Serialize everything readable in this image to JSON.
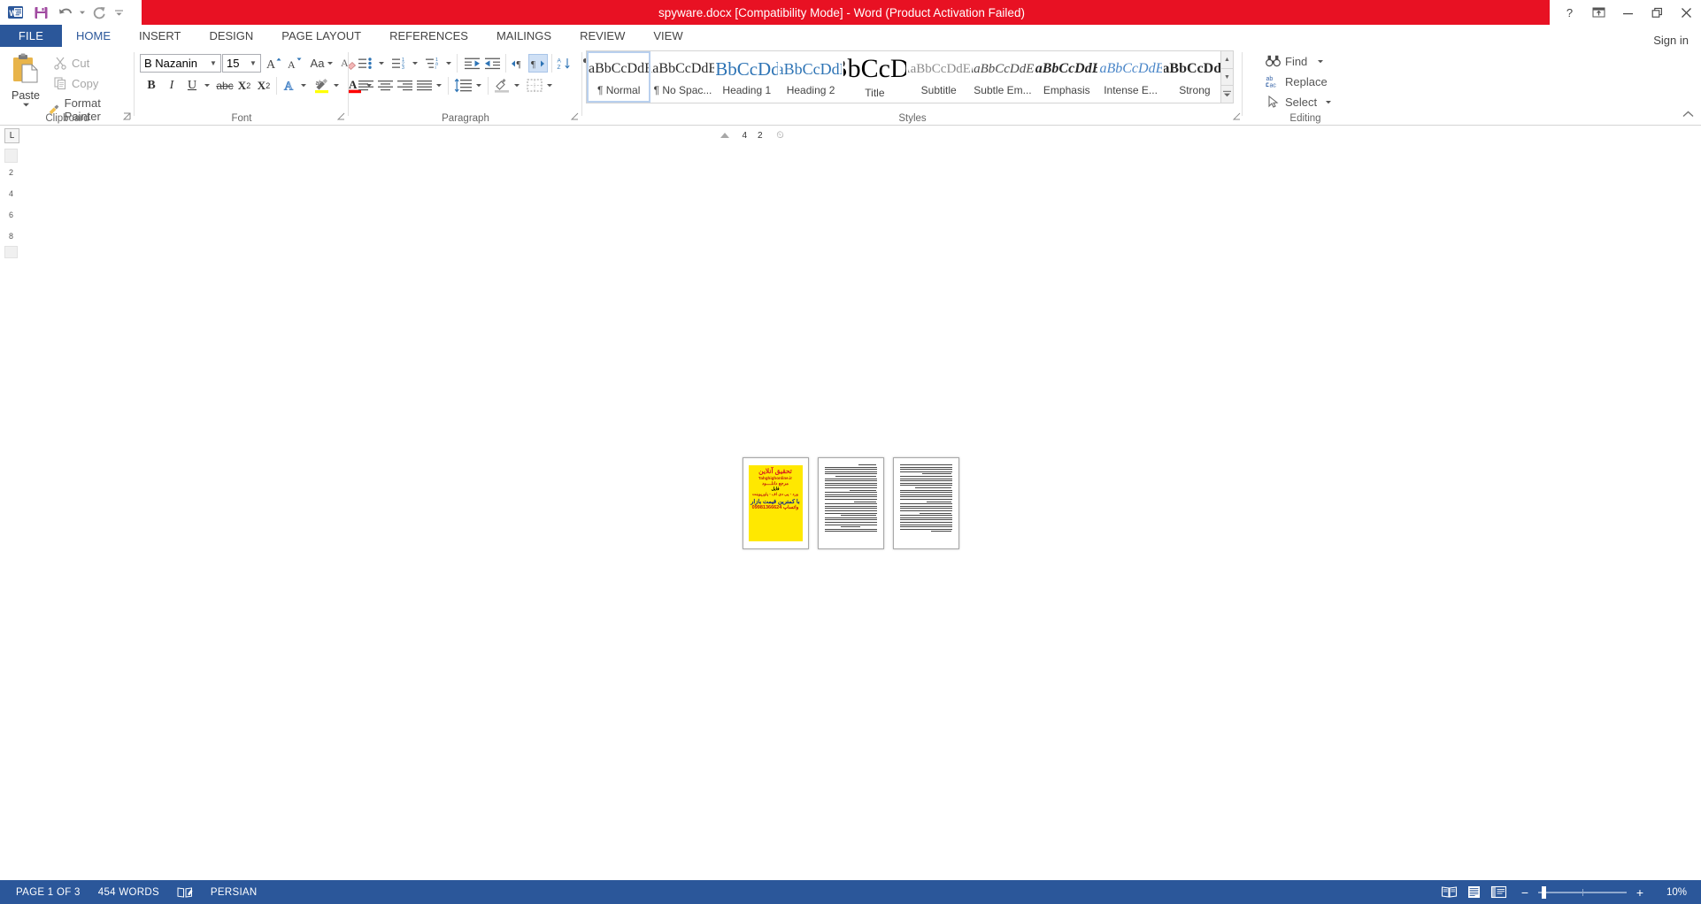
{
  "titlebar": {
    "title": "spyware.docx [Compatibility Mode]  -  Word (Product Activation Failed)",
    "quick_access": [
      {
        "name": "word-logo-icon",
        "label": "W"
      },
      {
        "name": "save-icon",
        "label": "Save"
      },
      {
        "name": "undo-icon",
        "label": "Undo"
      },
      {
        "name": "redo-icon",
        "label": "Redo"
      },
      {
        "name": "customize-qat-icon",
        "label": "Customize Quick Access Toolbar"
      }
    ],
    "help": "?",
    "ribbon_display": "Ribbon Display Options",
    "minimize": "—",
    "restore": "❐",
    "close": "✕",
    "accent_red": "#e81123",
    "accent_blue": "#2b579a"
  },
  "tabs": {
    "file": "FILE",
    "items": [
      {
        "label": "HOME",
        "active": true
      },
      {
        "label": "INSERT",
        "active": false
      },
      {
        "label": "DESIGN",
        "active": false
      },
      {
        "label": "PAGE LAYOUT",
        "active": false
      },
      {
        "label": "REFERENCES",
        "active": false
      },
      {
        "label": "MAILINGS",
        "active": false
      },
      {
        "label": "REVIEW",
        "active": false
      },
      {
        "label": "VIEW",
        "active": false
      }
    ],
    "signin": "Sign in"
  },
  "ribbon": {
    "clipboard": {
      "group_label": "Clipboard",
      "paste": "Paste",
      "cut": "Cut",
      "copy": "Copy",
      "format_painter": "Format Painter"
    },
    "font": {
      "group_label": "Font",
      "font_name": "B Nazanin",
      "font_size": "15",
      "grow_font": "A",
      "shrink_font": "A",
      "change_case": "Aa",
      "clear_formatting": "Clear All Formatting",
      "bold": "B",
      "italic": "I",
      "underline": "U",
      "strikethrough": "abc",
      "subscript": "X",
      "subscript_sub": "2",
      "superscript": "X",
      "superscript_sup": "2",
      "text_effects": "A",
      "highlight": "ab",
      "font_color": "A",
      "highlight_color": "#ffff00",
      "font_color_value": "#ff0000"
    },
    "paragraph": {
      "group_label": "Paragraph",
      "bullets": "Bullets",
      "numbering": "Numbering",
      "multilevel": "Multilevel List",
      "decrease_indent": "Decrease Indent",
      "increase_indent": "Increase Indent",
      "ltr": "Left-to-Right Text Direction",
      "rtl": "Right-to-Left Text Direction",
      "rtl_active": true,
      "sort": "Sort",
      "show_marks": "Show/Hide ¶",
      "align_left": "Align Left",
      "align_center": "Center",
      "align_right": "Align Right",
      "justify": "Justify",
      "line_spacing": "Line and Paragraph Spacing",
      "shading": "Shading",
      "borders": "Borders"
    },
    "styles": {
      "group_label": "Styles",
      "items": [
        {
          "preview": "AaBbCcDdEe",
          "name": "¶ Normal",
          "selected": true,
          "color": "#2a2a2a",
          "size": 16,
          "style": "normal",
          "weight": "normal"
        },
        {
          "preview": "AaBbCcDdEe",
          "name": "¶ No Spac...",
          "selected": false,
          "color": "#2a2a2a",
          "size": 16,
          "style": "normal",
          "weight": "normal"
        },
        {
          "preview": "AaBbCcDdEe",
          "name": "Heading 1",
          "selected": false,
          "color": "#2e74b5",
          "size": 21,
          "style": "normal",
          "weight": "normal"
        },
        {
          "preview": "AaBbCcDdEe",
          "name": "Heading 2",
          "selected": false,
          "color": "#2e74b5",
          "size": 18,
          "style": "normal",
          "weight": "normal"
        },
        {
          "preview": "AaBbCcDdEe",
          "name": "Title",
          "selected": false,
          "color": "#000000",
          "size": 30,
          "style": "normal",
          "weight": "normal"
        },
        {
          "preview": "AaBbCcDdEe",
          "name": "Subtitle",
          "selected": false,
          "color": "#8c8c8c",
          "size": 15,
          "style": "normal",
          "weight": "normal"
        },
        {
          "preview": "AaBbCcDdEe",
          "name": "Subtle Em...",
          "selected": false,
          "color": "#4a4a4a",
          "size": 15,
          "style": "italic",
          "weight": "normal"
        },
        {
          "preview": "AaBbCcDdEe",
          "name": "Emphasis",
          "selected": false,
          "color": "#2a2a2a",
          "size": 16,
          "style": "italic",
          "weight": "bold"
        },
        {
          "preview": "AaBbCcDdEe",
          "name": "Intense E...",
          "selected": false,
          "color": "#4a86c8",
          "size": 16,
          "style": "italic",
          "weight": "normal"
        },
        {
          "preview": "AaBbCcDdEe",
          "name": "Strong",
          "selected": false,
          "color": "#2a2a2a",
          "size": 16,
          "style": "normal",
          "weight": "bold"
        }
      ],
      "scroll_up": "▲",
      "scroll_down": "▼",
      "more": "☰"
    },
    "editing": {
      "group_label": "Editing",
      "find": "Find",
      "replace": "Replace",
      "select": "Select"
    },
    "collapse": "Collapse the Ribbon"
  },
  "ruler": {
    "corner_tab": "L",
    "marks": [
      "4",
      "2"
    ],
    "vertical_marks": [
      "2",
      "4",
      "6",
      "8"
    ]
  },
  "document": {
    "page_count": 3,
    "pages": [
      {
        "index": 1,
        "ad": {
          "line1": "تحقیق آنلاین",
          "line2": "Tahghighonline.ir",
          "line3": "مرجع دانلــــود",
          "line4": "فایل",
          "line5": "ورد - پی دی اف - پاورپوینت",
          "line6": "با کمترین قیمت بازار",
          "line7": "09981366624 واتساپ"
        },
        "body_lines": 4
      },
      {
        "index": 2,
        "body_lines": 30
      },
      {
        "index": 3,
        "body_lines": 30
      }
    ]
  },
  "statusbar": {
    "page": "PAGE 1 OF 3",
    "words": "454 WORDS",
    "proofing_icon": "proofing-errors-icon",
    "language": "PERSIAN",
    "views": [
      {
        "name": "read-mode-icon",
        "label": "Read Mode"
      },
      {
        "name": "print-layout-icon",
        "label": "Print Layout"
      },
      {
        "name": "web-layout-icon",
        "label": "Web Layout"
      }
    ],
    "zoom_out": "−",
    "zoom_in": "+",
    "zoom_value": "10%"
  }
}
